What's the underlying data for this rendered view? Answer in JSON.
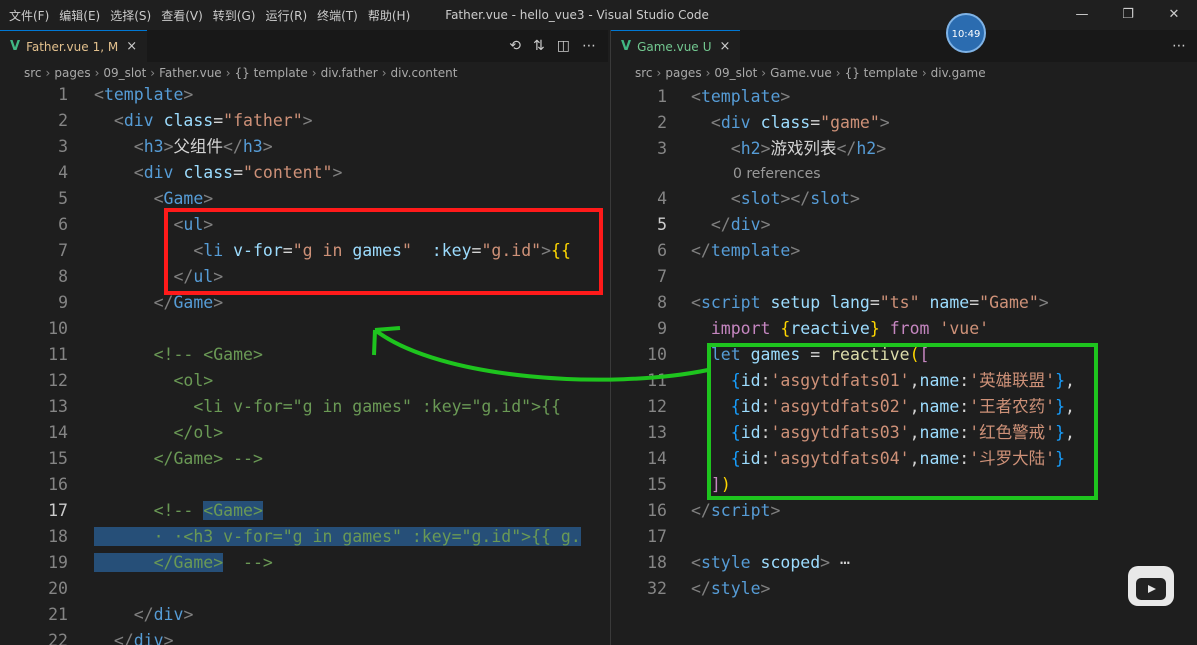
{
  "menu": [
    "文件(F)",
    "编辑(E)",
    "选择(S)",
    "查看(V)",
    "转到(G)",
    "运行(R)",
    "终端(T)",
    "帮助(H)"
  ],
  "window_title": "Father.vue - hello_vue3 - Visual Studio Code",
  "clock": "10:49",
  "left": {
    "tab": {
      "name": "Father.vue",
      "status": "1, M",
      "close": "×"
    },
    "breadcrumb": [
      "src",
      "pages",
      "09_slot",
      "Father.vue",
      "{} template",
      "div.father",
      "div.content"
    ]
  },
  "right": {
    "tab": {
      "name": "Game.vue",
      "status": "U",
      "close": "×"
    },
    "breadcrumb": [
      "src",
      "pages",
      "09_slot",
      "Game.vue",
      "{} template",
      "div.game"
    ],
    "codelens": "0 references"
  },
  "left_lines": [
    {
      "n": "1",
      "tokens": [
        [
          "br",
          "<"
        ],
        [
          "tag",
          "template"
        ],
        [
          "br",
          ">"
        ]
      ]
    },
    {
      "n": "2",
      "tokens": [
        [
          "p",
          "  "
        ],
        [
          "br",
          "<"
        ],
        [
          "tag",
          "div"
        ],
        [
          "p",
          " "
        ],
        [
          "attr",
          "class"
        ],
        [
          "p",
          "="
        ],
        [
          "str",
          "\"father\""
        ],
        [
          "br",
          ">"
        ]
      ]
    },
    {
      "n": "3",
      "tokens": [
        [
          "p",
          "    "
        ],
        [
          "br",
          "<"
        ],
        [
          "tag",
          "h3"
        ],
        [
          "br",
          ">"
        ],
        [
          "p",
          "父组件"
        ],
        [
          "br",
          "</"
        ],
        [
          "tag",
          "h3"
        ],
        [
          "br",
          ">"
        ]
      ]
    },
    {
      "n": "4",
      "tokens": [
        [
          "p",
          "    "
        ],
        [
          "br",
          "<"
        ],
        [
          "tag",
          "div"
        ],
        [
          "p",
          " "
        ],
        [
          "attr",
          "class"
        ],
        [
          "p",
          "="
        ],
        [
          "str",
          "\"content\""
        ],
        [
          "br",
          ">"
        ]
      ]
    },
    {
      "n": "5",
      "tokens": [
        [
          "p",
          "      "
        ],
        [
          "br",
          "<"
        ],
        [
          "tag2",
          "Game"
        ],
        [
          "br",
          ">"
        ]
      ]
    },
    {
      "n": "6",
      "tokens": [
        [
          "p",
          "        "
        ],
        [
          "br",
          "<"
        ],
        [
          "tag",
          "ul"
        ],
        [
          "br",
          ">"
        ]
      ]
    },
    {
      "n": "7",
      "tokens": [
        [
          "p",
          "          "
        ],
        [
          "br",
          "<"
        ],
        [
          "tag",
          "li"
        ],
        [
          "p",
          " "
        ],
        [
          "attr",
          "v-for"
        ],
        [
          "p",
          "="
        ],
        [
          "str",
          "\"g in "
        ],
        [
          "attr",
          "games"
        ],
        [
          "str",
          "\""
        ],
        [
          "p",
          "  "
        ],
        [
          "attr",
          ":key"
        ],
        [
          "p",
          "="
        ],
        [
          "str",
          "\"g.id\""
        ],
        [
          "br",
          ">"
        ],
        [
          "brk",
          "{{"
        ]
      ]
    },
    {
      "n": "8",
      "tokens": [
        [
          "p",
          "        "
        ],
        [
          "br",
          "</"
        ],
        [
          "tag",
          "ul"
        ],
        [
          "br",
          ">"
        ]
      ]
    },
    {
      "n": "9",
      "tokens": [
        [
          "p",
          "      "
        ],
        [
          "br",
          "</"
        ],
        [
          "tag2",
          "Game"
        ],
        [
          "br",
          ">"
        ]
      ]
    },
    {
      "n": "10",
      "tokens": []
    },
    {
      "n": "11",
      "tokens": [
        [
          "p",
          "      "
        ],
        [
          "cmt",
          "<!-- <Game>"
        ]
      ]
    },
    {
      "n": "12",
      "tokens": [
        [
          "p",
          "        "
        ],
        [
          "cmt",
          "<ol>"
        ]
      ]
    },
    {
      "n": "13",
      "tokens": [
        [
          "p",
          "          "
        ],
        [
          "cmt",
          "<li v-for=\"g in games\" :key=\"g.id\">{{"
        ]
      ]
    },
    {
      "n": "14",
      "tokens": [
        [
          "p",
          "        "
        ],
        [
          "cmt",
          "</ol>"
        ]
      ]
    },
    {
      "n": "15",
      "tokens": [
        [
          "p",
          "      "
        ],
        [
          "cmt",
          "</Game> -->"
        ]
      ]
    },
    {
      "n": "16",
      "tokens": []
    },
    {
      "n": "17",
      "tokens": [
        [
          "p",
          "      "
        ],
        [
          "cmt",
          "<!-- "
        ],
        [
          "cmthl",
          "<Game>"
        ]
      ]
    },
    {
      "n": "18",
      "tokens": [
        [
          "cmthl",
          "      · ·<h3 v-for=\"g in games\" :key=\"g.id\">{{ g."
        ]
      ]
    },
    {
      "n": "19",
      "tokens": [
        [
          "cmthl",
          "      </Game>"
        ],
        [
          "cmt",
          "  -->"
        ]
      ]
    },
    {
      "n": "20",
      "tokens": []
    },
    {
      "n": "21",
      "tokens": [
        [
          "p",
          "    "
        ],
        [
          "br",
          "</"
        ],
        [
          "tag",
          "div"
        ],
        [
          "br",
          ">"
        ]
      ]
    },
    {
      "n": "22",
      "tokens": [
        [
          "p",
          "  "
        ],
        [
          "br",
          "</"
        ],
        [
          "tag",
          "div"
        ],
        [
          "br",
          ">"
        ]
      ]
    }
  ],
  "right_lines": [
    {
      "n": "1",
      "tokens": [
        [
          "br",
          "<"
        ],
        [
          "tag",
          "template"
        ],
        [
          "br",
          ">"
        ]
      ]
    },
    {
      "n": "2",
      "tokens": [
        [
          "p",
          "  "
        ],
        [
          "br",
          "<"
        ],
        [
          "tag",
          "div"
        ],
        [
          "p",
          " "
        ],
        [
          "attr",
          "class"
        ],
        [
          "p",
          "="
        ],
        [
          "str",
          "\"game\""
        ],
        [
          "br",
          ">"
        ]
      ]
    },
    {
      "n": "3",
      "tokens": [
        [
          "p",
          "    "
        ],
        [
          "br",
          "<"
        ],
        [
          "tag",
          "h2"
        ],
        [
          "br",
          ">"
        ],
        [
          "p",
          "游戏列表"
        ],
        [
          "br",
          "</"
        ],
        [
          "tag",
          "h2"
        ],
        [
          "br",
          ">"
        ]
      ]
    },
    {
      "n": "4",
      "tokens": [
        [
          "p",
          "    "
        ],
        [
          "br",
          "<"
        ],
        [
          "tag",
          "slot"
        ],
        [
          "br",
          "></"
        ],
        [
          "tag",
          "slot"
        ],
        [
          "br",
          ">"
        ]
      ]
    },
    {
      "n": "5",
      "tokens": [
        [
          "p",
          "  "
        ],
        [
          "br",
          "</"
        ],
        [
          "tag",
          "div"
        ],
        [
          "br",
          ">"
        ]
      ]
    },
    {
      "n": "6",
      "tokens": [
        [
          "br",
          "</"
        ],
        [
          "tag",
          "template"
        ],
        [
          "br",
          ">"
        ]
      ]
    },
    {
      "n": "7",
      "tokens": []
    },
    {
      "n": "8",
      "tokens": [
        [
          "br",
          "<"
        ],
        [
          "tag",
          "script"
        ],
        [
          "p",
          " "
        ],
        [
          "attr",
          "setup"
        ],
        [
          "p",
          " "
        ],
        [
          "attr",
          "lang"
        ],
        [
          "p",
          "="
        ],
        [
          "str",
          "\"ts\""
        ],
        [
          "p",
          " "
        ],
        [
          "attr",
          "name"
        ],
        [
          "p",
          "="
        ],
        [
          "str",
          "\"Game\""
        ],
        [
          "br",
          ">"
        ]
      ]
    },
    {
      "n": "9",
      "tokens": [
        [
          "p",
          "  "
        ],
        [
          "kw",
          "import"
        ],
        [
          "p",
          " "
        ],
        [
          "brk",
          "{"
        ],
        [
          "attr",
          "reactive"
        ],
        [
          "brk",
          "}"
        ],
        [
          "p",
          " "
        ],
        [
          "kw",
          "from"
        ],
        [
          "p",
          " "
        ],
        [
          "str",
          "'vue'"
        ]
      ]
    },
    {
      "n": "10",
      "tokens": [
        [
          "p",
          "  "
        ],
        [
          "kw2",
          "let"
        ],
        [
          "p",
          " "
        ],
        [
          "attr",
          "games"
        ],
        [
          "p",
          " = "
        ],
        [
          "fn",
          "reactive"
        ],
        [
          "brk",
          "("
        ],
        [
          "kw",
          "["
        ]
      ]
    },
    {
      "n": "11",
      "tokens": [
        [
          "p",
          "    "
        ],
        [
          "blu",
          "{"
        ],
        [
          "attr",
          "id"
        ],
        [
          "p",
          ":"
        ],
        [
          "str",
          "'asgytdfats01'"
        ],
        [
          "p",
          ","
        ],
        [
          "attr",
          "name"
        ],
        [
          "p",
          ":"
        ],
        [
          "str",
          "'英雄联盟'"
        ],
        [
          "blu",
          "}"
        ],
        [
          "p",
          ","
        ]
      ]
    },
    {
      "n": "12",
      "tokens": [
        [
          "p",
          "    "
        ],
        [
          "blu",
          "{"
        ],
        [
          "attr",
          "id"
        ],
        [
          "p",
          ":"
        ],
        [
          "str",
          "'asgytdfats02'"
        ],
        [
          "p",
          ","
        ],
        [
          "attr",
          "name"
        ],
        [
          "p",
          ":"
        ],
        [
          "str",
          "'王者农药'"
        ],
        [
          "blu",
          "}"
        ],
        [
          "p",
          ","
        ]
      ]
    },
    {
      "n": "13",
      "tokens": [
        [
          "p",
          "    "
        ],
        [
          "blu",
          "{"
        ],
        [
          "attr",
          "id"
        ],
        [
          "p",
          ":"
        ],
        [
          "str",
          "'asgytdfats03'"
        ],
        [
          "p",
          ","
        ],
        [
          "attr",
          "name"
        ],
        [
          "p",
          ":"
        ],
        [
          "str",
          "'红色警戒'"
        ],
        [
          "blu",
          "}"
        ],
        [
          "p",
          ","
        ]
      ]
    },
    {
      "n": "14",
      "tokens": [
        [
          "p",
          "    "
        ],
        [
          "blu",
          "{"
        ],
        [
          "attr",
          "id"
        ],
        [
          "p",
          ":"
        ],
        [
          "str",
          "'asgytdfats04'"
        ],
        [
          "p",
          ","
        ],
        [
          "attr",
          "name"
        ],
        [
          "p",
          ":"
        ],
        [
          "str",
          "'斗罗大陆'"
        ],
        [
          "blu",
          "}"
        ]
      ]
    },
    {
      "n": "15",
      "tokens": [
        [
          "p",
          "  "
        ],
        [
          "kw",
          "]"
        ],
        [
          "brk",
          ")"
        ]
      ]
    },
    {
      "n": "16",
      "tokens": [
        [
          "br",
          "</"
        ],
        [
          "tag",
          "script"
        ],
        [
          "br",
          ">"
        ]
      ]
    },
    {
      "n": "17",
      "tokens": []
    },
    {
      "n": "18",
      "tokens": [
        [
          "br",
          "<"
        ],
        [
          "tag",
          "style"
        ],
        [
          "p",
          " "
        ],
        [
          "attr",
          "scoped"
        ],
        [
          "br",
          ">"
        ],
        [
          "p",
          " ⋯"
        ]
      ]
    },
    {
      "n": "32",
      "tokens": [
        [
          "br",
          "</"
        ],
        [
          "tag",
          "style"
        ],
        [
          "br",
          ">"
        ]
      ]
    }
  ]
}
